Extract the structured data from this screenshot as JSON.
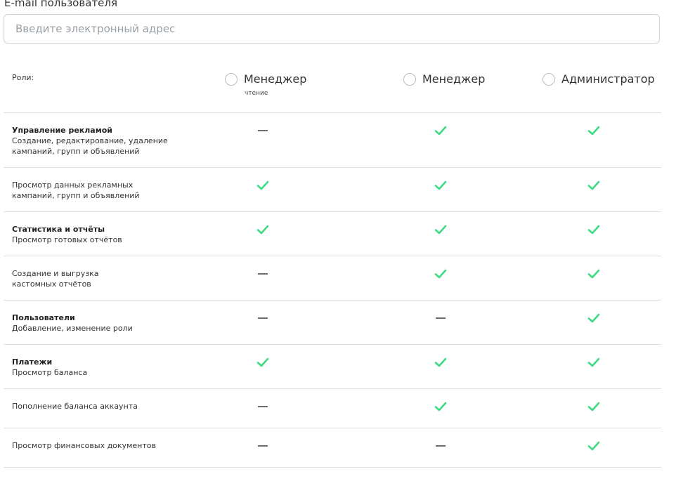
{
  "email": {
    "label": "E-mail пользователя",
    "placeholder": "Введите электронный адрес",
    "value": ""
  },
  "roles": {
    "label": "Роли:",
    "options": [
      {
        "name": "Менеджер",
        "sub": "чтение"
      },
      {
        "name": "Менеджер"
      },
      {
        "name": "Администратор"
      }
    ]
  },
  "icons": {
    "check": "check-icon",
    "dash": "dash-icon",
    "check_color": "#3ddc84",
    "dash_color": "#6b6f75"
  },
  "permissions": [
    {
      "title": "Управление рекламой",
      "desc": [
        "Создание, редактирование, удаление",
        "кампаний, групп и объявлений"
      ],
      "values": [
        "dash",
        "check",
        "check"
      ]
    },
    {
      "title": "",
      "desc": [
        "Просмотр данных рекламных",
        "кампаний, групп и объявлений"
      ],
      "values": [
        "check",
        "check",
        "check"
      ]
    },
    {
      "title": "Статистика и отчёты",
      "desc": [
        "Просмотр готовых отчётов"
      ],
      "values": [
        "check",
        "check",
        "check"
      ]
    },
    {
      "title": "",
      "desc": [
        "Создание и выгрузка",
        "кастомных отчётов"
      ],
      "values": [
        "dash",
        "check",
        "check"
      ]
    },
    {
      "title": "Пользователи",
      "desc": [
        "Добавление, изменение роли"
      ],
      "values": [
        "dash",
        "dash",
        "check"
      ]
    },
    {
      "title": "Платежи",
      "desc": [
        "Просмотр баланса"
      ],
      "values": [
        "check",
        "check",
        "check"
      ]
    },
    {
      "title": "",
      "desc": [
        "Пополнение баланса аккаунта"
      ],
      "values": [
        "dash",
        "check",
        "check"
      ]
    },
    {
      "title": "",
      "desc": [
        "Просмотр финансовых документов"
      ],
      "values": [
        "dash",
        "dash",
        "check"
      ]
    }
  ]
}
